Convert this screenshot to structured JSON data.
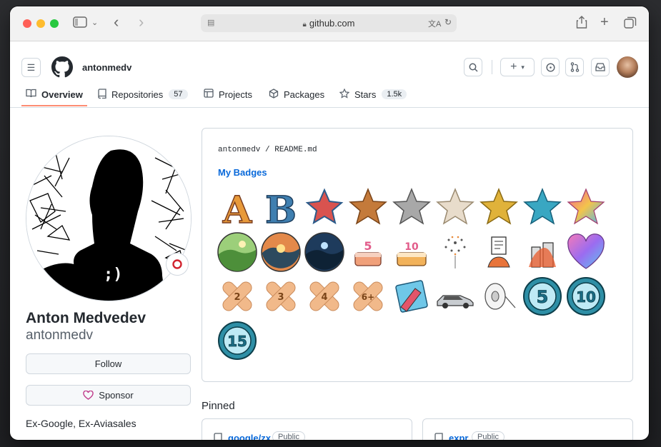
{
  "browser": {
    "url": "github.com",
    "traffic_lights": [
      "#ff5f57",
      "#febc2e",
      "#28c840"
    ]
  },
  "header": {
    "username": "antonmedv",
    "tabs": [
      {
        "label": "Overview",
        "icon": "book-icon"
      },
      {
        "label": "Repositories",
        "icon": "repo-icon",
        "count": "57"
      },
      {
        "label": "Projects",
        "icon": "table-icon"
      },
      {
        "label": "Packages",
        "icon": "package-icon"
      },
      {
        "label": "Stars",
        "icon": "star-icon",
        "count": "1.5k"
      }
    ]
  },
  "profile": {
    "name": "Anton Medvedev",
    "login": "antonmedv",
    "follow_label": "Follow",
    "sponsor_label": "Sponsor",
    "bio": "Ex-Google, Ex-Aviasales"
  },
  "readme": {
    "path": "antonmedv / README.md",
    "title": "My Badges",
    "badge_count": 28
  },
  "pinned": {
    "title": "Pinned",
    "items": [
      {
        "name": "google/zx",
        "visibility": "Public"
      },
      {
        "name": "expr",
        "visibility": "Public"
      }
    ]
  },
  "colors": {
    "accent": "#0969da",
    "active_tab_underline": "#fd8c73",
    "text": "#24292f"
  }
}
